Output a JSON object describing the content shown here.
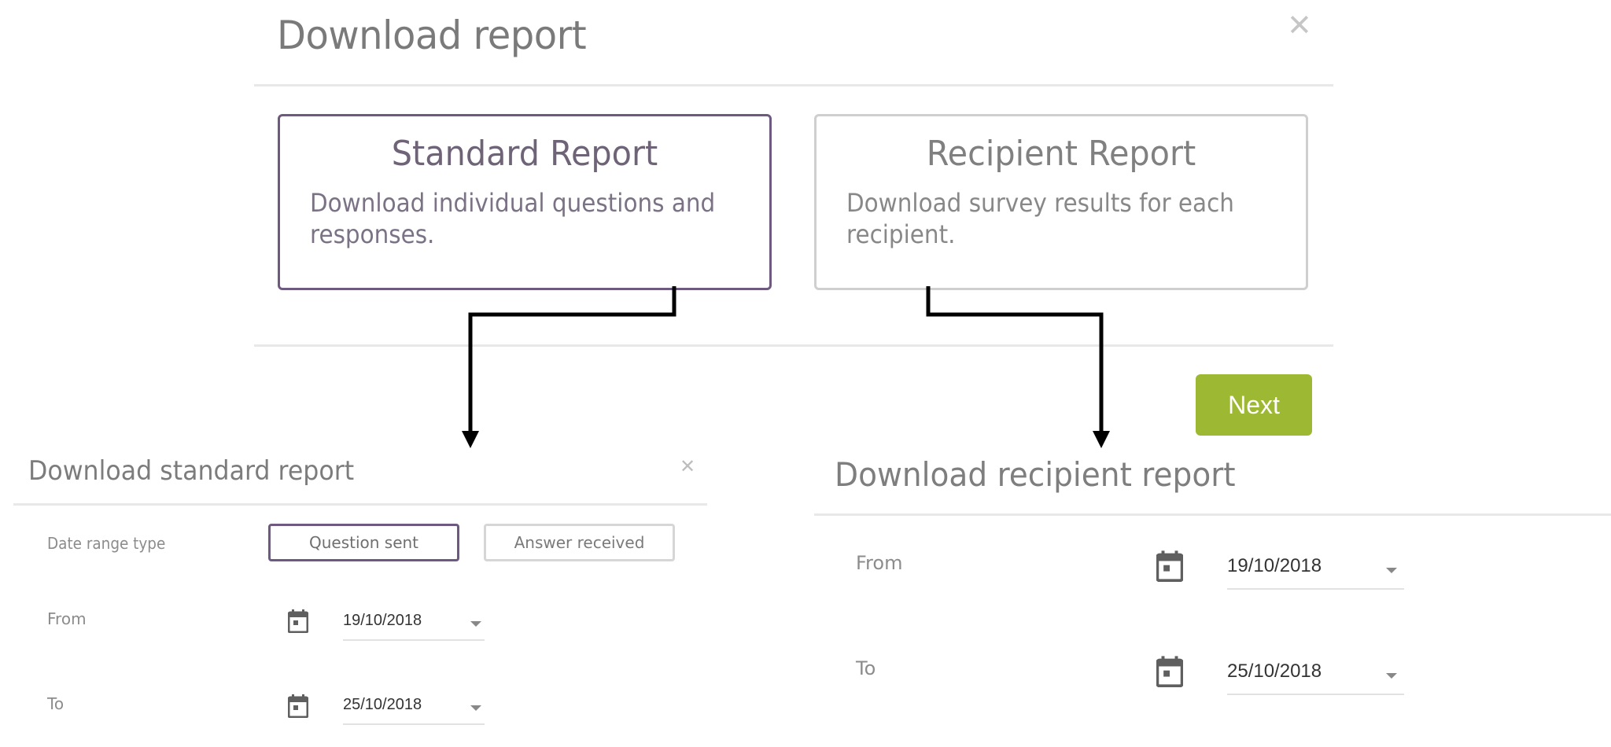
{
  "top_modal": {
    "title": "Download report",
    "close_icon": "close-icon",
    "cards": [
      {
        "id": "standard",
        "title": "Standard Report",
        "description": "Download individual questions and responses.",
        "selected": true
      },
      {
        "id": "recipient",
        "title": "Recipient Report",
        "description": "Download survey results for each recipient.",
        "selected": false
      }
    ],
    "next_label": "Next"
  },
  "standard_panel": {
    "title": "Download standard report",
    "close_icon": "close-icon",
    "date_range_type_label": "Date range type",
    "date_range_options": [
      {
        "label": "Question sent",
        "selected": true
      },
      {
        "label": "Answer received",
        "selected": false
      }
    ],
    "from_label": "From",
    "from_value": "19/10/2018",
    "to_label": "To",
    "to_value": "25/10/2018"
  },
  "recipient_panel": {
    "title": "Download recipient report",
    "from_label": "From",
    "from_value": "19/10/2018",
    "to_label": "To",
    "to_value": "25/10/2018"
  },
  "colors": {
    "accent_purple": "#6e5a80",
    "next_green": "#9db832",
    "connector": "#000000"
  }
}
